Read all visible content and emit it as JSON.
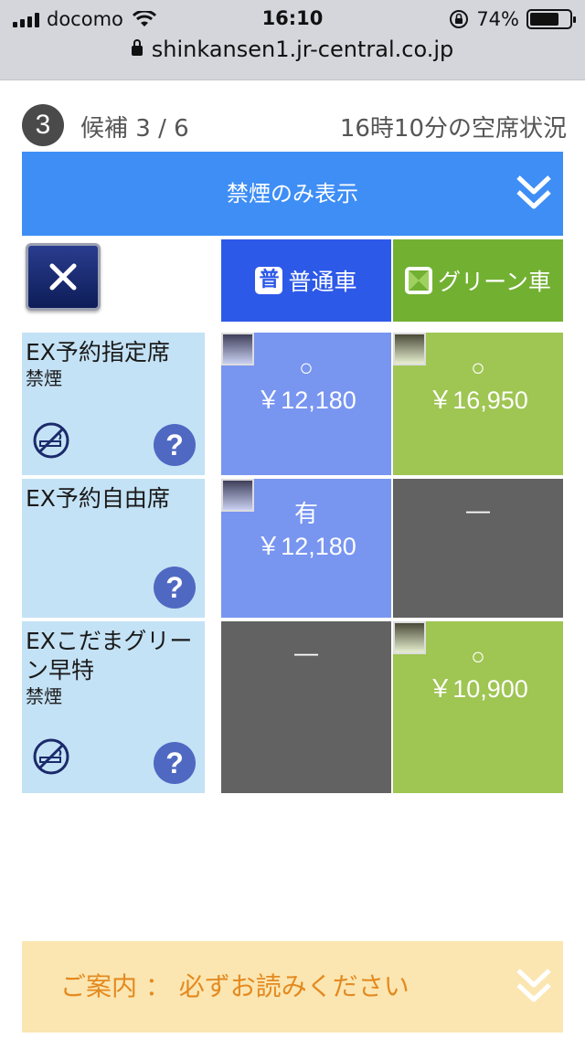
{
  "status": {
    "carrier": "docomo",
    "time": "16:10",
    "battery": "74%",
    "battery_level": 0.74,
    "url": "shinkansen1.jr-central.co.jp"
  },
  "header": {
    "step": "3",
    "candidate": "候補 3 / 6",
    "vacancy_time": "16時10分の空席状況"
  },
  "filter": {
    "label": "禁煙のみ表示"
  },
  "classes": {
    "ordinary_badge": "普",
    "ordinary": "普通車",
    "green": "グリーン車"
  },
  "rows": [
    {
      "title": "EX予約指定席",
      "sub": "禁煙",
      "ordinary": {
        "symbol": "○",
        "price": "￥12,180"
      },
      "green": {
        "symbol": "○",
        "price": "￥16,950"
      }
    },
    {
      "title": "EX予約自由席",
      "sub": "",
      "ordinary": {
        "symbol": "有",
        "price": "￥12,180"
      },
      "green": {
        "symbol": "—",
        "price": ""
      }
    },
    {
      "title": "EXこだまグリーン早特",
      "sub": "禁煙",
      "ordinary": {
        "symbol": "—",
        "price": ""
      },
      "green": {
        "symbol": "○",
        "price": "￥10,900"
      }
    }
  ],
  "help_label": "?",
  "notice": {
    "label": "ご案内 ： 必ずお読みください"
  },
  "colors": {
    "accent_blue": "#3e8ef5",
    "ordinary_class": "#2d59e8",
    "green_class": "#72b032",
    "cell_blue": "#7895f0",
    "cell_green": "#9fc553",
    "cell_unavailable": "#626262",
    "row_label_bg": "#c4e2f5",
    "notice_bg": "#fbe6b1",
    "notice_text": "#e48a20"
  }
}
